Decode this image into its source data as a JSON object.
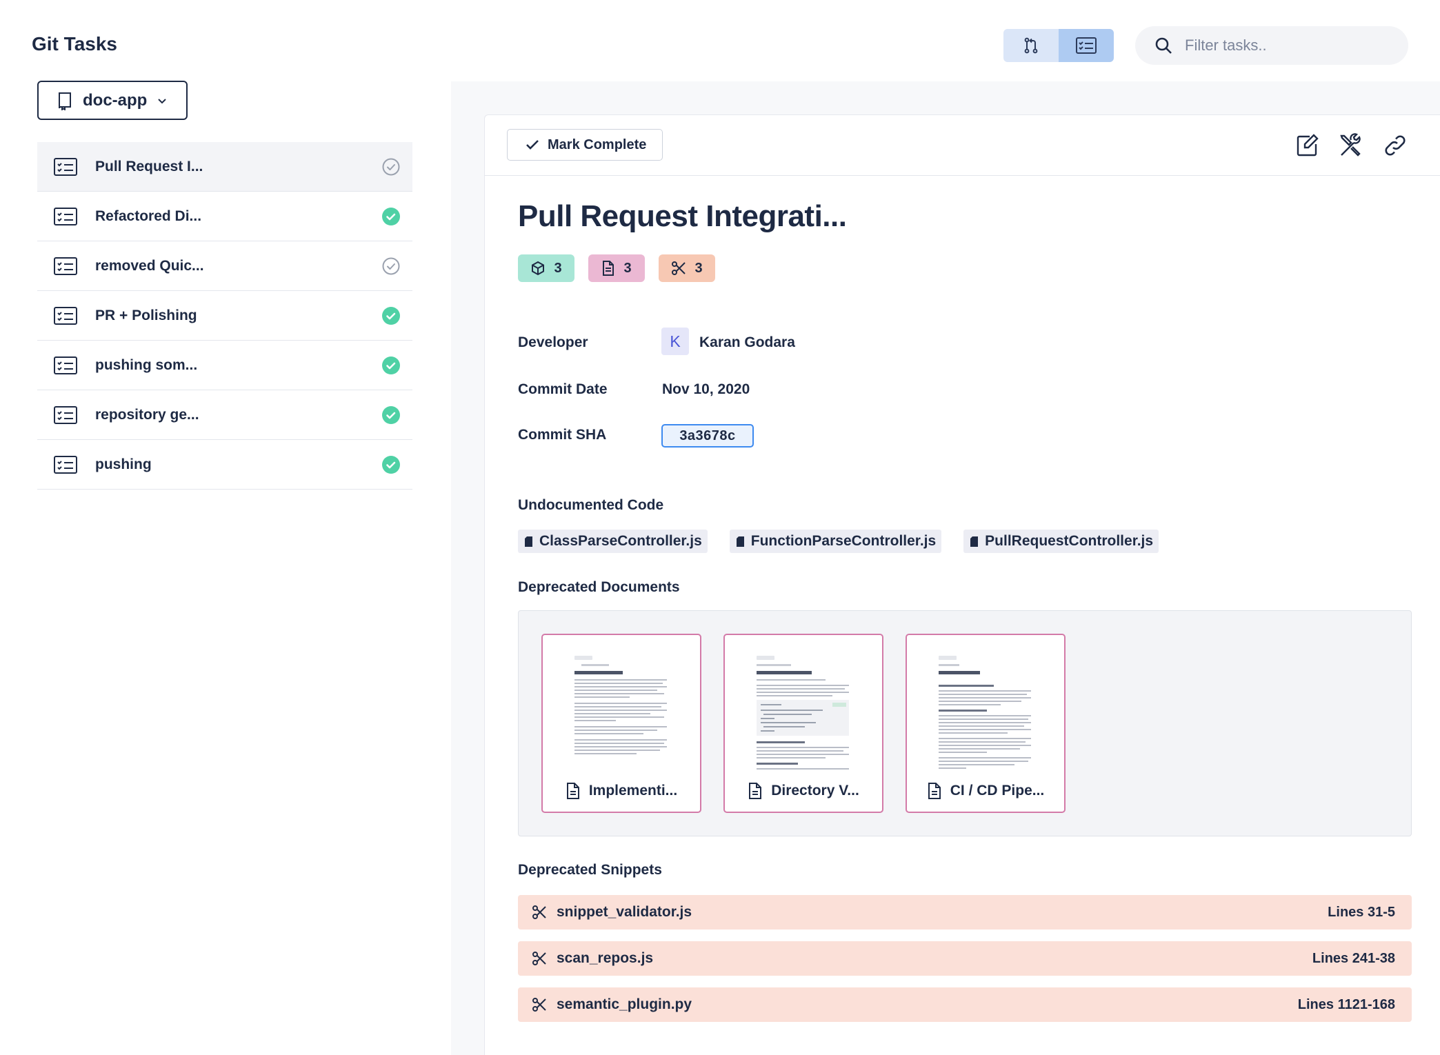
{
  "app": {
    "title": "Git Tasks"
  },
  "repo": {
    "name": "doc-app",
    "icon": "repo-book-icon"
  },
  "toolbar": {
    "view_toggle": [
      {
        "name": "pull-request-view",
        "icon": "git-pull-request-icon",
        "selected": false
      },
      {
        "name": "task-list-view",
        "icon": "checklist-icon",
        "selected": true
      }
    ],
    "search": {
      "placeholder": "Filter tasks..",
      "value": ""
    }
  },
  "tasks": [
    {
      "label": "Pull Request I...",
      "status": "pending",
      "active": true
    },
    {
      "label": "Refactored Di...",
      "status": "complete",
      "active": false
    },
    {
      "label": "removed Quic...",
      "status": "pending",
      "active": false
    },
    {
      "label": "PR + Polishing",
      "status": "complete",
      "active": false
    },
    {
      "label": "pushing som...",
      "status": "complete",
      "active": false
    },
    {
      "label": "repository ge...",
      "status": "complete",
      "active": false
    },
    {
      "label": "pushing",
      "status": "complete",
      "active": false
    }
  ],
  "detail": {
    "mark_complete_label": "Mark Complete",
    "actions": [
      "edit-icon",
      "tools-icon",
      "link-icon"
    ],
    "title": "Pull Request Integrati...",
    "badges": [
      {
        "icon": "cube-icon",
        "count": "3",
        "color": "#a8e6d6"
      },
      {
        "icon": "document-icon",
        "count": "3",
        "color": "#ebb8d3"
      },
      {
        "icon": "scissors-icon",
        "count": "3",
        "color": "#f7c8b3"
      }
    ],
    "developer_label": "Developer",
    "developer_initial": "K",
    "developer_name": "Karan Godara",
    "commit_date_label": "Commit Date",
    "commit_date": "Nov 10, 2020",
    "commit_sha_label": "Commit SHA",
    "commit_sha": "3a3678c",
    "undocumented_title": "Undocumented Code",
    "undocumented_files": [
      "ClassParseController.js",
      "FunctionParseController.js",
      "PullRequestController.js"
    ],
    "deprecated_docs_title": "Deprecated Documents",
    "deprecated_docs": [
      "Implementi...",
      "Directory V...",
      "CI / CD Pipe..."
    ],
    "deprecated_snippets_title": "Deprecated Snippets",
    "deprecated_snippets": [
      {
        "name": "snippet_validator.js",
        "lines": "Lines 31-5"
      },
      {
        "name": "scan_repos.js",
        "lines": "Lines 241-38"
      },
      {
        "name": "semantic_plugin.py",
        "lines": "Lines 1121-168"
      }
    ]
  },
  "colors": {
    "text": "#1e2a44",
    "complete_green": "#4fd1a5",
    "pending_gray": "#9aa1ae",
    "doc_border": "#d37aa8",
    "snippet_bg": "#fbe0d8",
    "sha_border": "#3d8af0"
  }
}
